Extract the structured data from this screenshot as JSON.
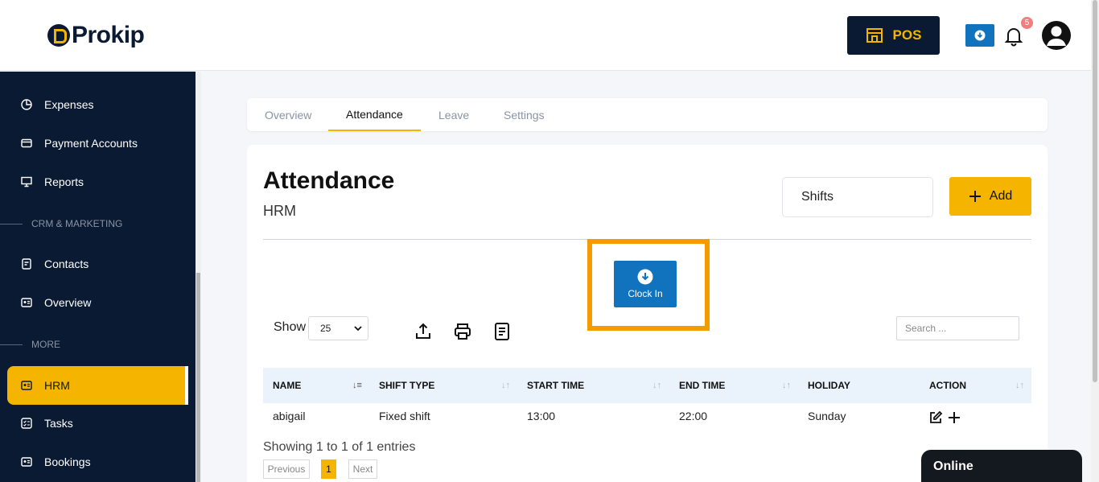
{
  "brand": {
    "name": "Prokip"
  },
  "header": {
    "pos_label": "POS",
    "notification_count": "5"
  },
  "sidebar": {
    "items": [
      {
        "label": "Expenses",
        "icon": "pie-chart-icon"
      },
      {
        "label": "Payment Accounts",
        "icon": "wallet-icon"
      },
      {
        "label": "Reports",
        "icon": "presentation-icon"
      }
    ],
    "section_crm": "CRM & MARKETING",
    "crm_items": [
      {
        "label": "Contacts",
        "icon": "document-icon"
      },
      {
        "label": "Overview",
        "icon": "id-card-icon"
      }
    ],
    "section_more": "MORE",
    "more_items": [
      {
        "label": "HRM",
        "icon": "id-card-icon",
        "active": true
      },
      {
        "label": "Tasks",
        "icon": "checklist-icon"
      },
      {
        "label": "Bookings",
        "icon": "id-card-icon"
      }
    ]
  },
  "tabs": [
    {
      "label": "Overview",
      "active": false
    },
    {
      "label": "Attendance",
      "active": true
    },
    {
      "label": "Leave",
      "active": false
    },
    {
      "label": "Settings",
      "active": false
    }
  ],
  "main": {
    "title": "Attendance",
    "subtitle": "HRM",
    "shifts_label": "Shifts",
    "add_label": "Add",
    "clock_in_label": "Clock In",
    "show_label": "Show",
    "page_size": "25",
    "search_placeholder": "Search ..."
  },
  "table": {
    "columns": [
      "NAME",
      "SHIFT TYPE",
      "START TIME",
      "END TIME",
      "HOLIDAY",
      "ACTION"
    ],
    "rows": [
      {
        "name": "abigail",
        "shift_type": "Fixed shift",
        "start_time": "13:00",
        "end_time": "22:00",
        "holiday": "Sunday"
      }
    ]
  },
  "pagination": {
    "summary": "Showing 1 to 1 of 1 entries",
    "previous": "Previous",
    "current": "1",
    "next": "Next"
  },
  "chat": {
    "status": "Online"
  },
  "colors": {
    "navy": "#0b1a33",
    "accent": "#f5b400",
    "blue": "#1173bd",
    "highlight": "#f59b00"
  }
}
